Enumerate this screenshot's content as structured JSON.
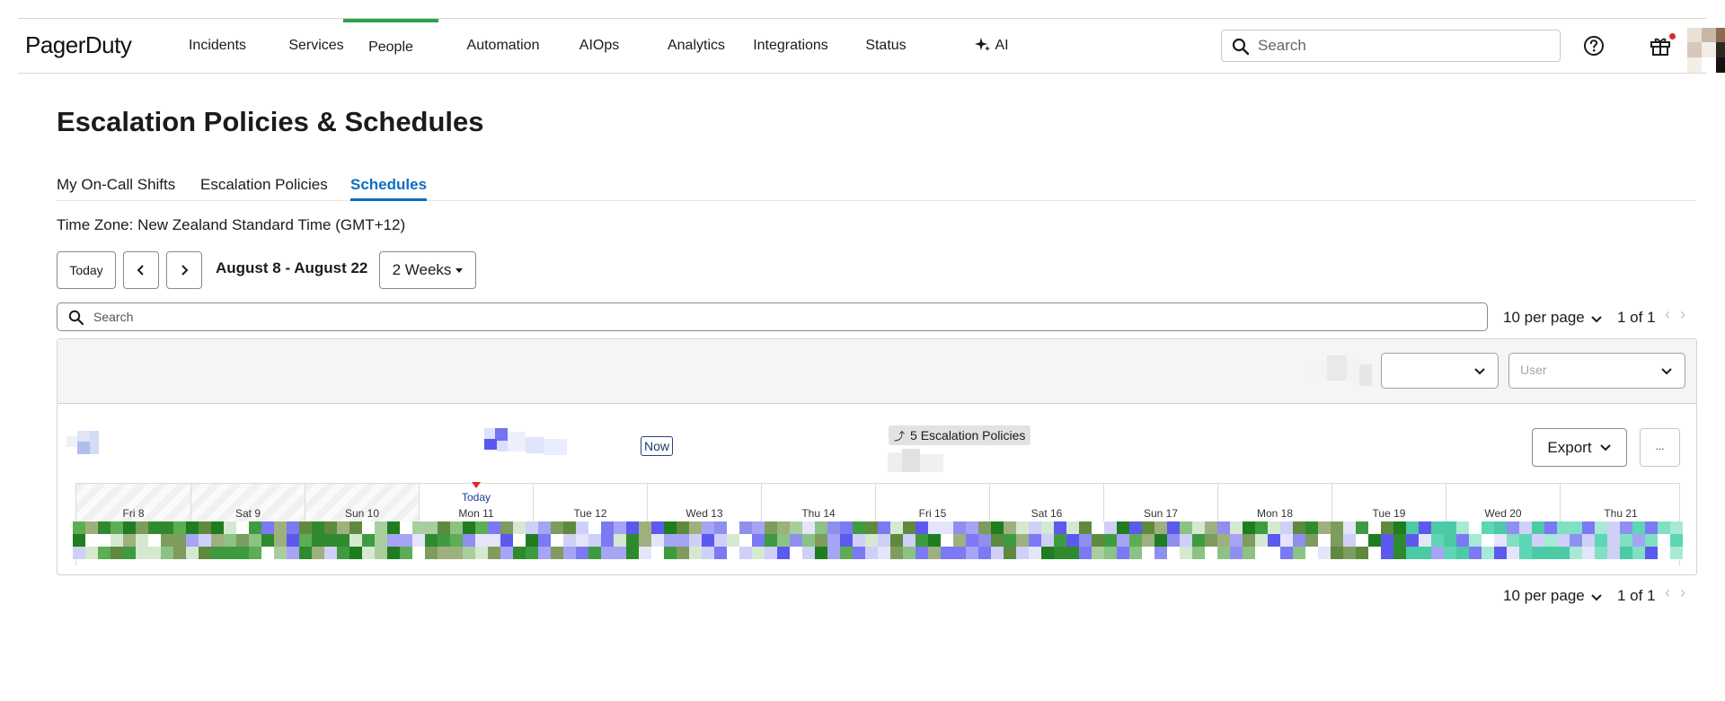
{
  "nav": {
    "logo": "PagerDuty",
    "items": [
      {
        "label": "Incidents",
        "active": false
      },
      {
        "label": "Services",
        "active": false
      },
      {
        "label": "People",
        "active": true
      },
      {
        "label": "Automation",
        "active": false
      },
      {
        "label": "AIOps",
        "active": false
      },
      {
        "label": "Analytics",
        "active": false
      },
      {
        "label": "Integrations",
        "active": false
      },
      {
        "label": "Status",
        "active": false
      },
      {
        "label": "AI",
        "active": false,
        "icon": "sparkle-icon"
      }
    ],
    "search_placeholder": "Search",
    "icons": [
      "help-icon",
      "gift-icon",
      "avatar"
    ]
  },
  "page": {
    "title": "Escalation Policies & Schedules",
    "tabs": [
      {
        "label": "My On-Call Shifts",
        "active": false
      },
      {
        "label": "Escalation Policies",
        "active": false
      },
      {
        "label": "Schedules",
        "active": true
      }
    ],
    "timezone": "Time Zone: New Zealand Standard Time (GMT+12)"
  },
  "controls": {
    "today_label": "Today",
    "range_label": "August 8 - August 22",
    "period_label": "2 Weeks",
    "search_placeholder": "Search",
    "per_page_label": "10 per page",
    "page_of": "1 of 1"
  },
  "card": {
    "filter_user_placeholder": "User",
    "now_label": "Now",
    "escalation_badge": "5 Escalation Policies",
    "export_label": "Export",
    "more_label": "...",
    "today_label": "Today",
    "days": [
      "Fri 8",
      "Sat 9",
      "Sun 10",
      "Mon 11",
      "Tue 12",
      "Wed 13",
      "Thu 14",
      "Fri 15",
      "Sat 16",
      "Sun 17",
      "Mon 18",
      "Tue 19",
      "Wed 20",
      "Thu 21"
    ],
    "today_index": 3
  },
  "footer": {
    "per_page_label": "10 per page",
    "page_of": "1 of 1"
  },
  "colors": {
    "accent": "#2ba24c",
    "link": "#0b6ec2",
    "now_marker": "#e3262c"
  }
}
